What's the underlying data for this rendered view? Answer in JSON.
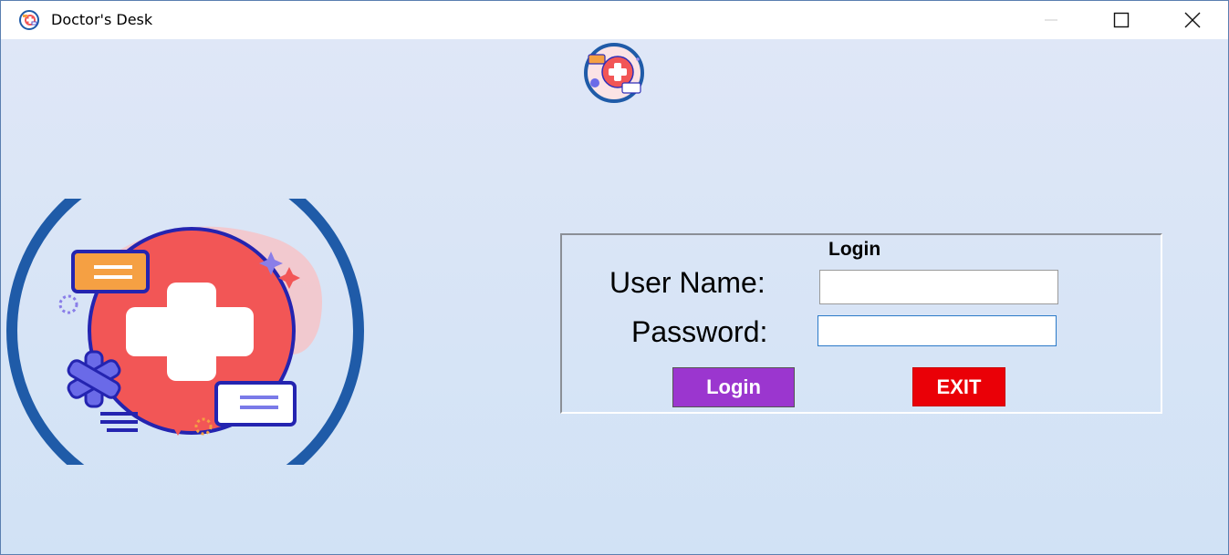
{
  "window": {
    "title": "Doctor's Desk",
    "controls": {
      "minimize": "—",
      "maximize": "☐",
      "close": "✕"
    }
  },
  "logo": {
    "icon": "medical-cross-badge-icon"
  },
  "login": {
    "heading": "Login",
    "username_label": "User Name:",
    "username_value": "",
    "password_label": "Password:",
    "password_value": "",
    "login_button": "Login",
    "exit_button": "EXIT"
  },
  "colors": {
    "login_button": "#9b36cf",
    "exit_button": "#ea0007",
    "background": "#d8e4f6",
    "logo_ring": "#1f5ba8",
    "logo_red": "#f25656"
  }
}
